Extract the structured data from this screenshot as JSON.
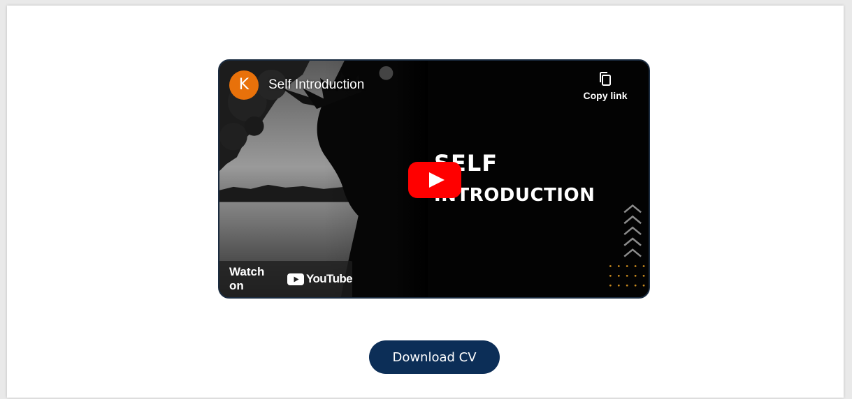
{
  "video": {
    "channel_initial": "K",
    "title": "Self Introduction",
    "copy_link_label": "Copy link",
    "headline_line1": "SELF",
    "headline_line2": "INTRODUCTION",
    "watch_on_label": "Watch on",
    "youtube_wordmark": "YouTube",
    "colors": {
      "avatar": "#e8710a",
      "play_button": "#ff0000",
      "border": "#1b2c40"
    }
  },
  "actions": {
    "download_cv_label": "Download CV",
    "download_cv_color": "#0c2e57"
  }
}
